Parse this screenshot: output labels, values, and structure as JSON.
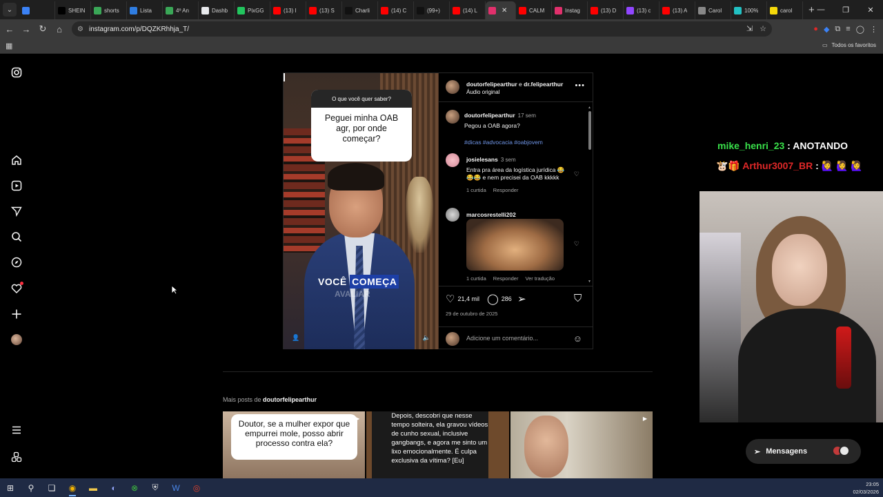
{
  "browser": {
    "tabs": [
      {
        "title": "",
        "color": "#3b82f6"
      },
      {
        "title": "SHEIN",
        "color": "#000000"
      },
      {
        "title": "shorts",
        "color": "#3aa757"
      },
      {
        "title": "Lista",
        "color": "#2f7de1"
      },
      {
        "title": "4º An",
        "color": "#3aa757"
      },
      {
        "title": "Dashb",
        "color": "#e8eaed"
      },
      {
        "title": "PixGG",
        "color": "#22c55e"
      },
      {
        "title": "(13) I",
        "color": "#ff0000"
      },
      {
        "title": "(13) S",
        "color": "#ff0000"
      },
      {
        "title": "Charli",
        "color": "#111111"
      },
      {
        "title": "(14) C",
        "color": "#ff0000"
      },
      {
        "title": "(99+)",
        "color": "#111111"
      },
      {
        "title": "(14) L",
        "color": "#ff0000"
      },
      {
        "title": "",
        "color": "#e1306c",
        "active": true
      },
      {
        "title": "CALM",
        "color": "#ff0000"
      },
      {
        "title": "Instag",
        "color": "#e1306c"
      },
      {
        "title": "(13) D",
        "color": "#ff0000"
      },
      {
        "title": "(13) c",
        "color": "#9146ff"
      },
      {
        "title": "(13) A",
        "color": "#ff0000"
      },
      {
        "title": "Carol",
        "color": "#888888"
      },
      {
        "title": "100%",
        "color": "#22c1c3"
      },
      {
        "title": "carol",
        "color": "#f5d90a"
      }
    ],
    "url": "instagram.com/p/DQZKRhhja_T/",
    "bookmarks_all": "Todos os favoritos"
  },
  "post": {
    "header_user1": "doutorfelipearthur",
    "header_conj": " e ",
    "header_user2": "dr.felipearthur",
    "audio": "Áudio original",
    "question_prompt": "O que você quer saber?",
    "question_text": "Peguei minha OAB agr, por onde começar?",
    "caption_word1": "VOCÊ",
    "caption_word2": "COMEÇA",
    "caption_faded": "AVALIAR",
    "owner_comment": {
      "user": "doutorfelipearthur",
      "time": "17 sem",
      "text": "Pegou a OAB agora?",
      "hashtags": "#dicas #advocacia #oabjovem"
    },
    "comment1": {
      "user": "josielesans",
      "time": "3 sem",
      "text": "Entra pra área da logística jurídica 😂😂😂 e nem precisei da OAB kkkkk",
      "likes": "1 curtida",
      "reply": "Responder"
    },
    "comment2": {
      "user": "marcosrestelli202",
      "likes": "1 curtida",
      "reply": "Responder",
      "translate": "Ver tradução"
    },
    "likes_count": "21,4 mil",
    "comments_count": "286",
    "date": "29 de outubro de 2025",
    "add_comment_placeholder": "Adicione um comentário..."
  },
  "more_posts": {
    "label": "Mais posts de ",
    "user": "doutorfelipearthur",
    "thumb1_text": "Doutor, se a mulher expor que empurrei mole, posso abrir processo contra ela?",
    "thumb2_text": "Depois, descobri que nesse tempo solteira, ela gravou vídeos de cunho sexual, inclusive gangbangs, e agora me sinto um lixo emocionalmente. É culpa exclusiva da vítima? [Eu]"
  },
  "overlay": {
    "chat1_user": "mike_henri_23",
    "chat1_msg": " : ANOTANDO",
    "chat2_user": "Arthur3007_BR",
    "chat2_sep": " : ",
    "chat2_badges": "🐮🎁",
    "chat2_emotes": "🙋‍♀️ 🙋‍♀️ 🙋‍♀️"
  },
  "messages_label": "Mensagens",
  "taskbar": {
    "time": "23:05",
    "date": "02/03/2026"
  }
}
